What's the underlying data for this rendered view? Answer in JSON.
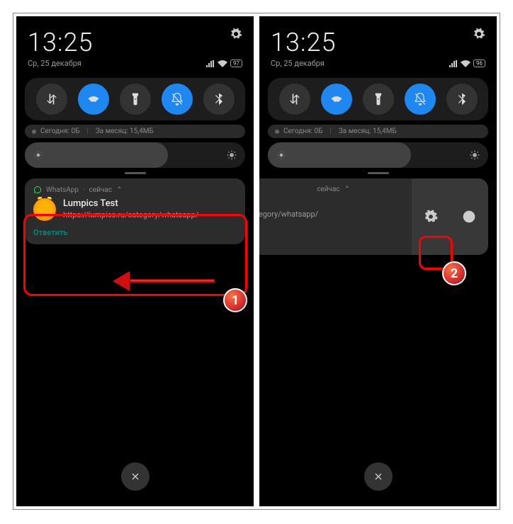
{
  "status": {
    "time": "13:25",
    "date": "Ср, 25 декабря",
    "battery_left": "97",
    "battery_right": "96"
  },
  "data_usage": {
    "today_label": "Сегодня: 0Б",
    "month_label": "За месяц: 15,4МБ"
  },
  "notification": {
    "app": "WhatsApp",
    "time": "сейчас",
    "sender": "Lumpics Test",
    "message": "https://lumpics.ru/category/whatsapp/",
    "reply_label": "Ответить"
  },
  "annotations": {
    "badge1": "1",
    "badge2": "2"
  }
}
